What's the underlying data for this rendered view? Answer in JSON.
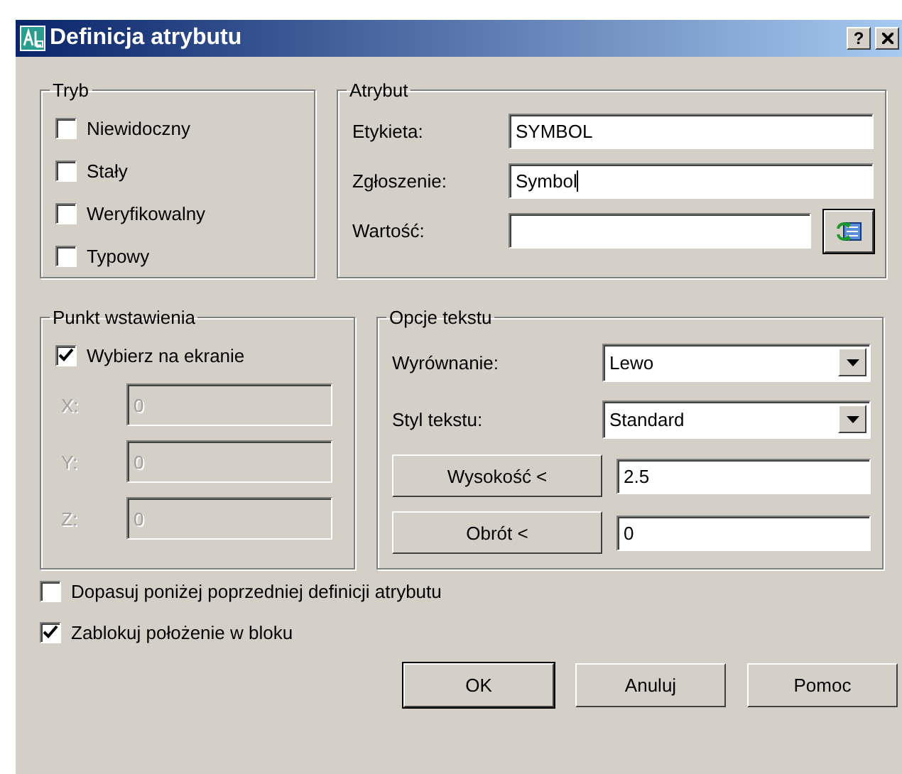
{
  "window": {
    "title": "Definicja atrybutu",
    "help_button": "?"
  },
  "mode": {
    "title": "Tryb",
    "options": [
      {
        "label": "Niewidoczny",
        "checked": false
      },
      {
        "label": "Stały",
        "checked": false
      },
      {
        "label": "Weryfikowalny",
        "checked": false
      },
      {
        "label": "Typowy",
        "checked": false
      }
    ]
  },
  "attribute": {
    "title": "Atrybut",
    "fields": [
      {
        "label": "Etykieta:",
        "value": "SYMBOL",
        "caret": false,
        "field_button": false
      },
      {
        "label": "Zgłoszenie:",
        "value": "Symbol",
        "caret": true,
        "field_button": false
      },
      {
        "label": "Wartość:",
        "caret": false,
        "field_button": true
      }
    ]
  },
  "insertion_point": {
    "title": "Punkt wstawienia",
    "pick_on_screen": {
      "label": "Wybierz na ekranie",
      "checked": true
    },
    "coords": [
      {
        "label": "X:",
        "value": "0",
        "disabled": true
      },
      {
        "label": "Y:",
        "value": "0",
        "disabled": true
      },
      {
        "label": "Z:",
        "value": "0",
        "disabled": true
      }
    ]
  },
  "text_options": {
    "title": "Opcje tekstu",
    "rows": [
      {
        "kind": "dropdown",
        "label": "Wyrównanie:",
        "value": "Lewo"
      },
      {
        "kind": "dropdown",
        "label": "Styl tekstu:",
        "value": "Standard"
      },
      {
        "kind": "button",
        "label": "Wysokość <",
        "value": "2.5"
      },
      {
        "kind": "button",
        "label": "Obrót <",
        "value": "0"
      }
    ]
  },
  "options": [
    {
      "label": "Dopasuj poniżej poprzedniej definicji atrybutu",
      "checked": false
    },
    {
      "label": "Zablokuj położenie w bloku",
      "checked": true
    }
  ],
  "buttons": [
    {
      "label": "OK",
      "default": true
    },
    {
      "label": "Anuluj",
      "default": false
    },
    {
      "label": "Pomoc",
      "default": false
    }
  ]
}
